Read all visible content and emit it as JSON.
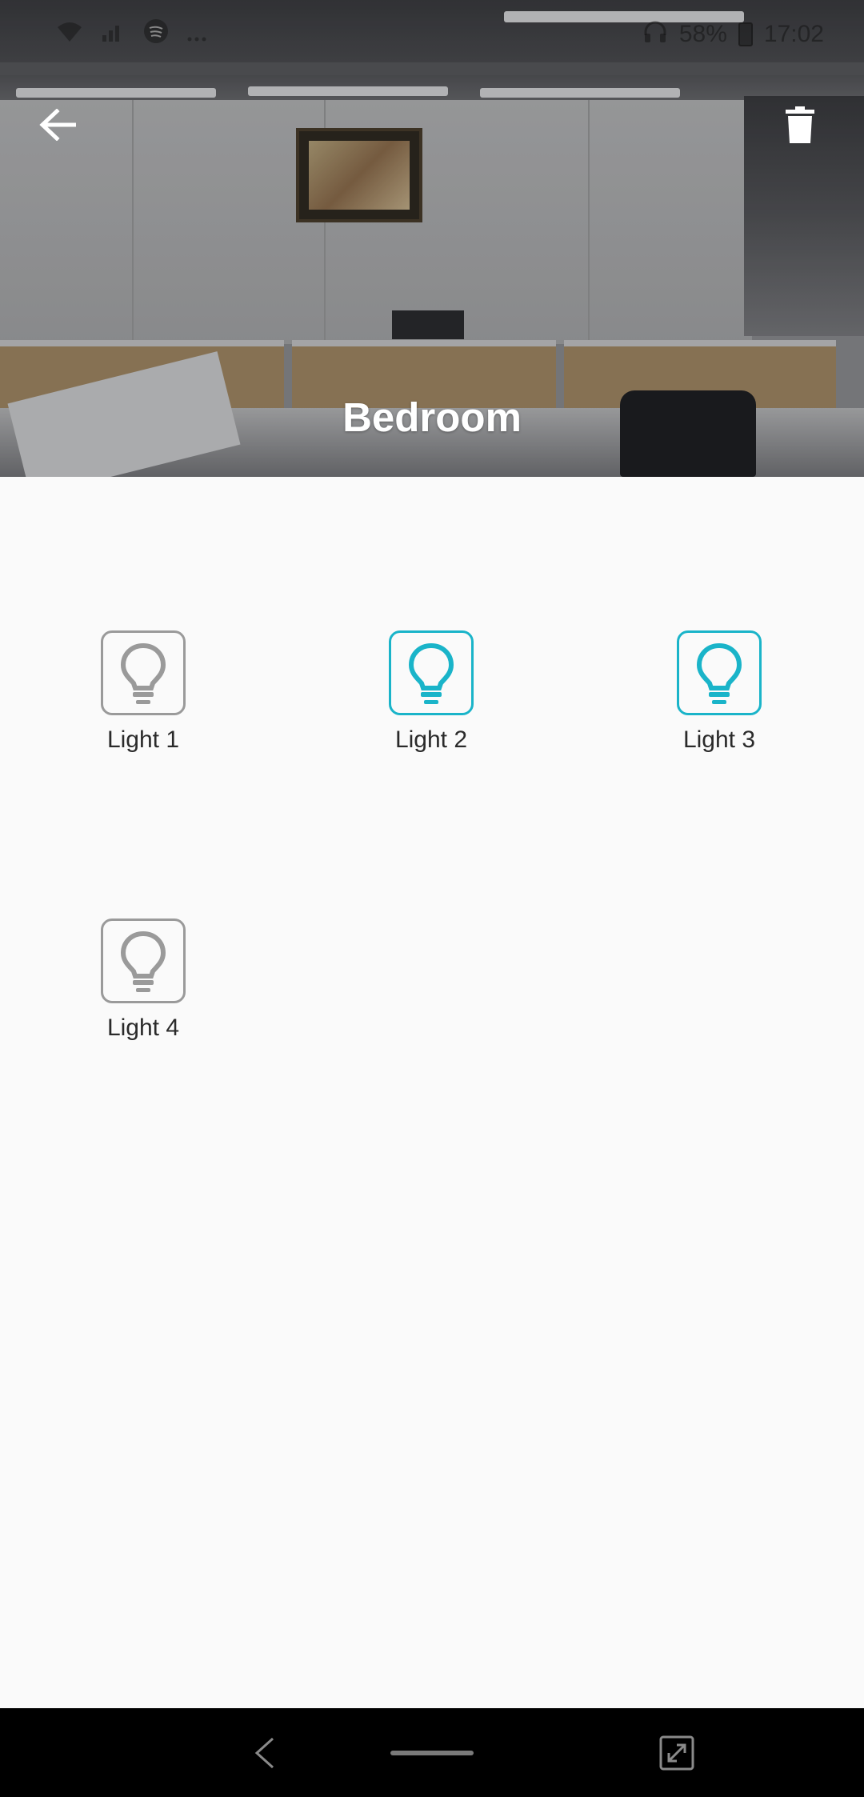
{
  "status_bar": {
    "battery": "58%",
    "time": "17:02",
    "icons": [
      "wifi-icon",
      "signal-icon",
      "spotify-icon",
      "more-icon",
      "headphones-icon",
      "battery-icon"
    ]
  },
  "header": {
    "title": "Bedroom",
    "back_icon": "arrow-left-icon",
    "delete_icon": "trash-icon"
  },
  "devices": [
    {
      "label": "Light 1",
      "state": "off",
      "icon": "lightbulb-icon"
    },
    {
      "label": "Light 2",
      "state": "on",
      "icon": "lightbulb-icon"
    },
    {
      "label": "Light 3",
      "state": "on",
      "icon": "lightbulb-icon"
    },
    {
      "label": "Light 4",
      "state": "off",
      "icon": "lightbulb-icon"
    }
  ],
  "colors": {
    "on": "#1ab4c9",
    "off": "#9a9a9a",
    "background": "#fafafa",
    "nav_bar": "#000000"
  },
  "nav_bar": {
    "buttons": [
      "back-nav-icon",
      "home-nav-pill",
      "rotate-screen-icon"
    ]
  }
}
